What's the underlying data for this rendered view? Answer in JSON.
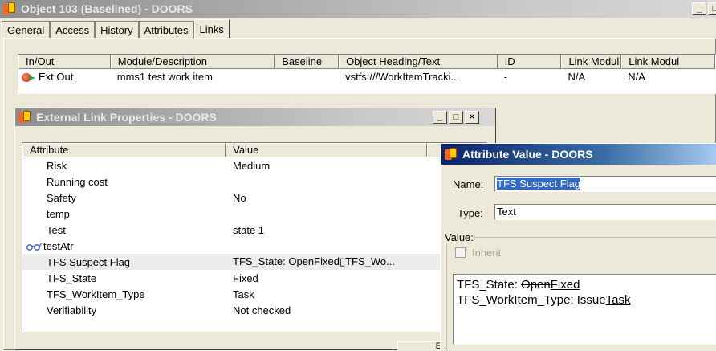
{
  "main_window": {
    "title": "Object 103 (Baselined) - DOORS",
    "tabs": [
      "General",
      "Access",
      "History",
      "Attributes",
      "Links"
    ],
    "active_tab": "Links",
    "links_table": {
      "columns": [
        "In/Out",
        "Module/Description",
        "Baseline",
        "Object Heading/Text",
        "ID",
        "Link Module",
        "Link Modul"
      ],
      "rows": [
        {
          "in_out": "Ext Out",
          "module": "mms1 test work item",
          "baseline": "",
          "heading": "vstfs:///WorkItemTracki...",
          "id": "-",
          "link_module": "N/A",
          "link_module2": "N/A"
        }
      ]
    }
  },
  "ext_link_window": {
    "title": "External Link Properties - DOORS",
    "columns": [
      "Attribute",
      "Value"
    ],
    "rows": [
      {
        "attr": "Risk",
        "value": "Medium"
      },
      {
        "attr": "Running cost",
        "value": ""
      },
      {
        "attr": "Safety",
        "value": "No"
      },
      {
        "attr": "temp",
        "value": ""
      },
      {
        "attr": "Test",
        "value": "state 1"
      },
      {
        "attr": "testAtr",
        "value": ""
      },
      {
        "attr": "TFS Suspect Flag",
        "value": "TFS_State: OpenFixed▯TFS_Wo..."
      },
      {
        "attr": "TFS_State",
        "value": "Fixed"
      },
      {
        "attr": "TFS_WorkItem_Type",
        "value": "Task"
      },
      {
        "attr": "Verifiability",
        "value": "Not checked"
      }
    ],
    "button_fragment": "E"
  },
  "attr_value_window": {
    "title": "Attribute Value - DOORS",
    "name_label": "Name:",
    "name_value": "TFS Suspect Flag",
    "type_label": "Type:",
    "type_value": "Text",
    "value_group_label": "Value:",
    "inherit_label": "Inherit",
    "inherit_checked": false,
    "text": {
      "line1_prefix": "TFS_State: ",
      "line1_old": "Open",
      "line1_new": "Fixed",
      "line2_prefix": "TFS_WorkItem_Type: ",
      "line2_old": "Issue",
      "line2_new": "Task"
    }
  },
  "colors": {
    "title_active": "#0a246a",
    "title_inactive": "#8e8e8e",
    "selection": "#316ac5",
    "face": "#ece9d8"
  }
}
